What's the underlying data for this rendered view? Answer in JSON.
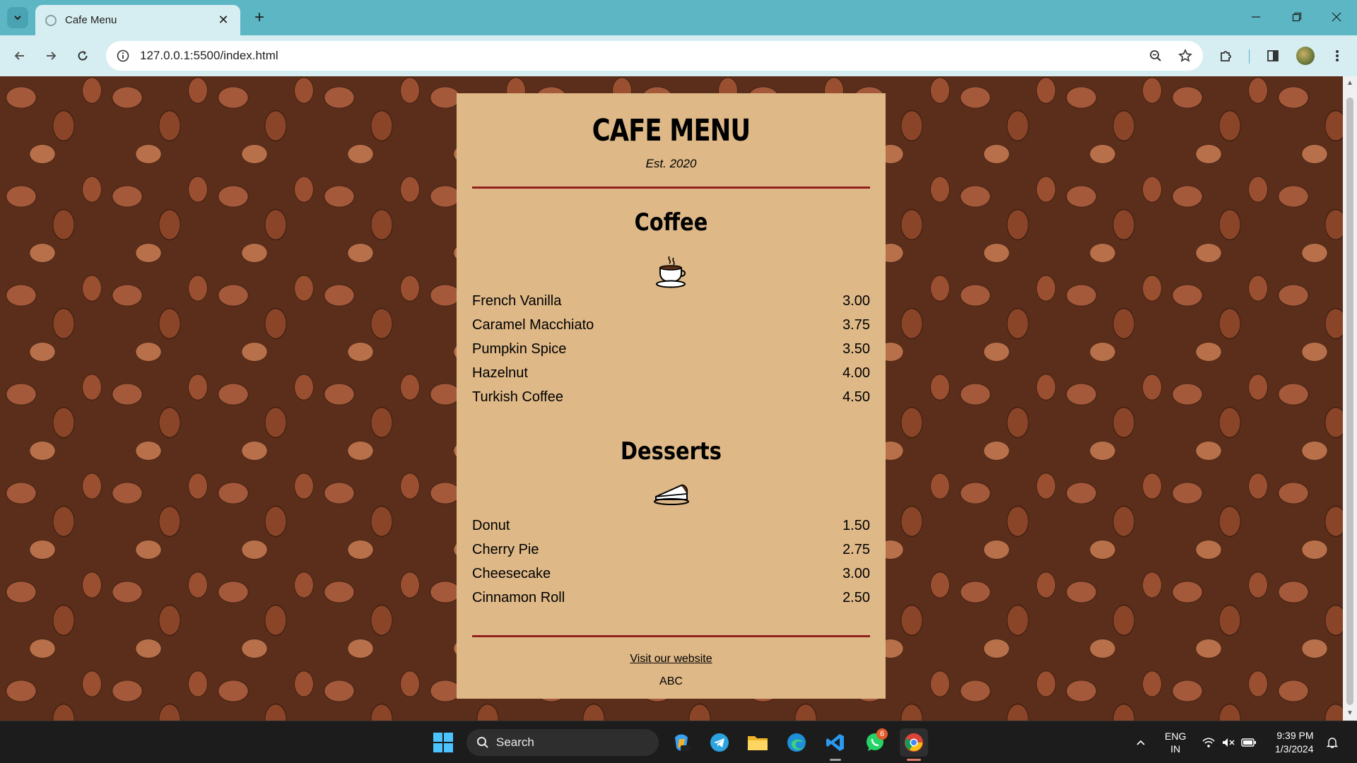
{
  "browser": {
    "tab_title": "Cafe Menu",
    "url": "127.0.0.1:5500/index.html"
  },
  "menu": {
    "title": "CAFE MENU",
    "established": "Est. 2020",
    "sections": {
      "coffee": {
        "title": "Coffee",
        "icon": "coffee-cup-icon",
        "items": [
          {
            "name": "French Vanilla",
            "price": "3.00"
          },
          {
            "name": "Caramel Macchiato",
            "price": "3.75"
          },
          {
            "name": "Pumpkin Spice",
            "price": "3.50"
          },
          {
            "name": "Hazelnut",
            "price": "4.00"
          },
          {
            "name": "Turkish Coffee",
            "price": "4.50"
          }
        ]
      },
      "desserts": {
        "title": "Desserts",
        "icon": "pie-slice-icon",
        "items": [
          {
            "name": "Donut",
            "price": "1.50"
          },
          {
            "name": "Cherry Pie",
            "price": "2.75"
          },
          {
            "name": "Cheesecake",
            "price": "3.00"
          },
          {
            "name": "Cinnamon Roll",
            "price": "2.50"
          }
        ]
      }
    },
    "footer": {
      "link_text": "Visit our website",
      "address": "ABC"
    },
    "colors": {
      "card_background": "#deb887",
      "divider": "#92201c"
    }
  },
  "taskbar": {
    "search_label": "Search",
    "whatsapp_badge": "6",
    "language_line1": "ENG",
    "language_line2": "IN",
    "time": "9:39 PM",
    "date": "1/3/2024"
  }
}
